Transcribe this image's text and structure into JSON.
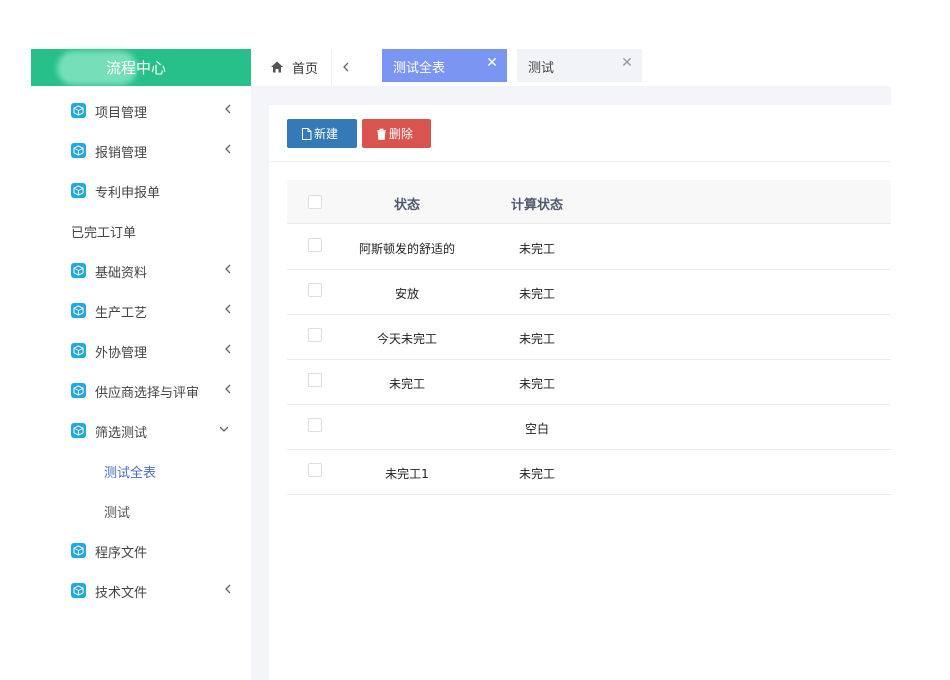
{
  "logo": {
    "title": "流程中心"
  },
  "sidebar": {
    "items": [
      {
        "label": "项目管理",
        "icon": "cube-icon",
        "arrow": "left"
      },
      {
        "label": "报销管理",
        "icon": "cube-icon",
        "arrow": "left"
      },
      {
        "label": "专利申报单",
        "icon": "cube-icon",
        "arrow": ""
      },
      {
        "label": "已完工订单",
        "icon": "",
        "arrow": ""
      },
      {
        "label": "基础资料",
        "icon": "cube-icon",
        "arrow": "left"
      },
      {
        "label": "生产工艺",
        "icon": "cube-icon",
        "arrow": "left"
      },
      {
        "label": "外协管理",
        "icon": "cube-icon",
        "arrow": "left"
      },
      {
        "label": "供应商选择与评审",
        "icon": "cube-icon",
        "arrow": "left"
      },
      {
        "label": "筛选测试",
        "icon": "cube-icon",
        "arrow": "down"
      },
      {
        "label": "测试全表",
        "sub": true,
        "active": true
      },
      {
        "label": "测试",
        "sub": true,
        "active": false
      },
      {
        "label": "程序文件",
        "icon": "cube-icon",
        "arrow": ""
      },
      {
        "label": "技术文件",
        "icon": "cube-icon",
        "arrow": "left"
      }
    ]
  },
  "tabs": {
    "home": "首页",
    "items": [
      {
        "label": "测试全表",
        "active": true
      },
      {
        "label": "测试",
        "active": false
      }
    ]
  },
  "toolbar": {
    "new_label": "新建",
    "delete_label": "删除"
  },
  "table": {
    "headers": {
      "status": "状态",
      "calc_status": "计算状态"
    },
    "rows": [
      {
        "status": "阿斯顿发的舒适的",
        "calc_status": "未完工"
      },
      {
        "status": "安放",
        "calc_status": "未完工"
      },
      {
        "status": "今天未完工",
        "calc_status": "未完工"
      },
      {
        "status": "未完工",
        "calc_status": "未完工"
      },
      {
        "status": "",
        "calc_status": "空白"
      },
      {
        "status": "未完工1",
        "calc_status": "未完工"
      }
    ]
  },
  "colors": {
    "logo_bg": "#27c08a",
    "active_tab": "#7b96f2",
    "btn_new": "#337ab7",
    "btn_delete": "#d9534f",
    "menu_icon": "#22a7e0"
  }
}
